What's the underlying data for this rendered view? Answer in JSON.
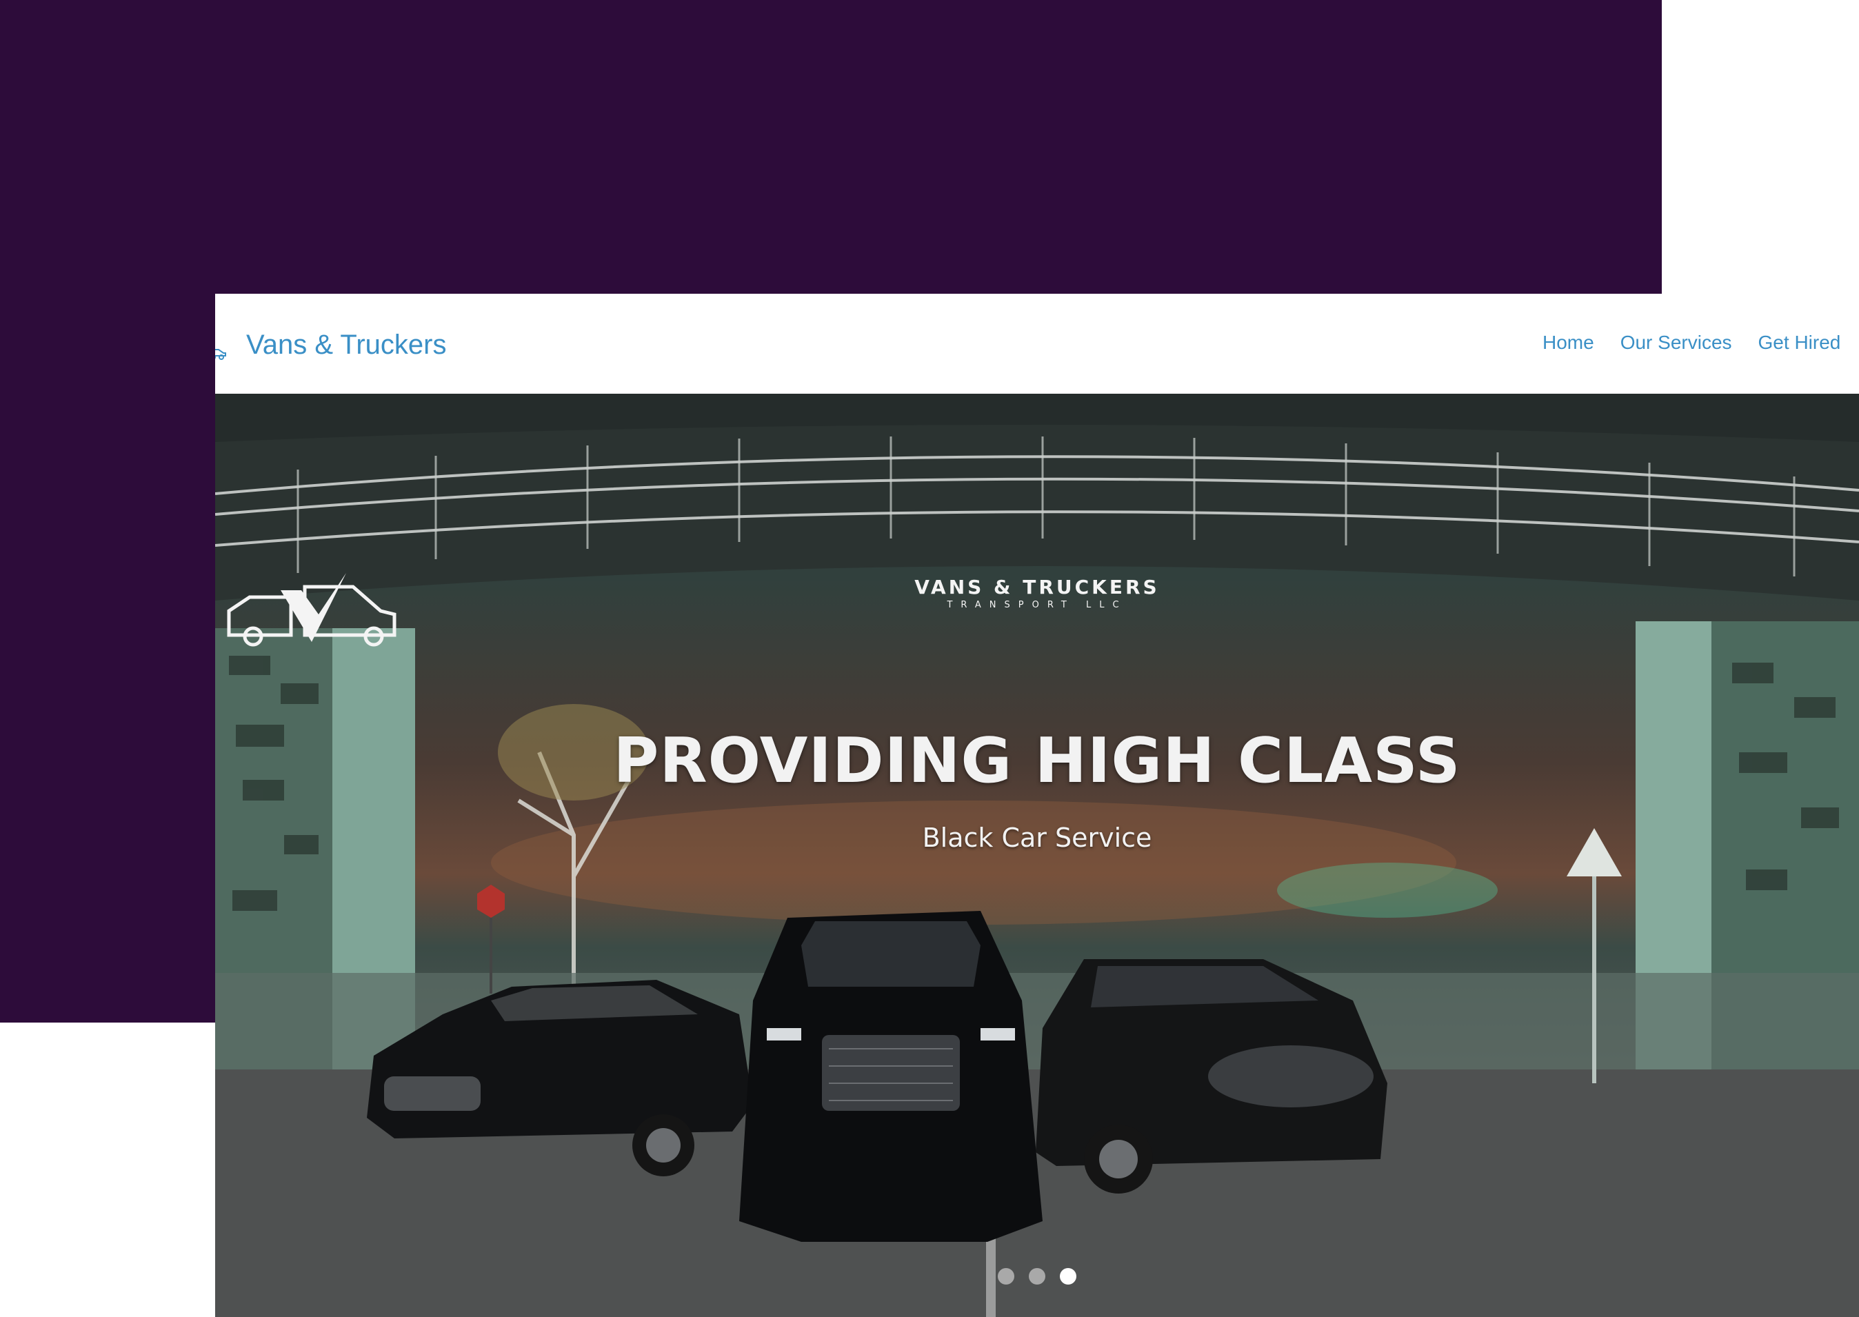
{
  "header": {
    "brand_name": "Vans & Truckers",
    "brand_icon": "van-icon",
    "nav": [
      {
        "label": "Home"
      },
      {
        "label": "Our Services"
      },
      {
        "label": "Get Hired"
      }
    ]
  },
  "hero": {
    "logo": {
      "line1": "VANS & TRUCKERS",
      "line2": "TRANSPORT LLC"
    },
    "title": "PROVIDING HIGH CLASS",
    "subtitle": "Black Car Service",
    "slider": {
      "slide_count": 3,
      "active_slide": 3
    }
  },
  "colors": {
    "accent": "#3a8fc6",
    "backdrop": "#2d0c3a"
  }
}
